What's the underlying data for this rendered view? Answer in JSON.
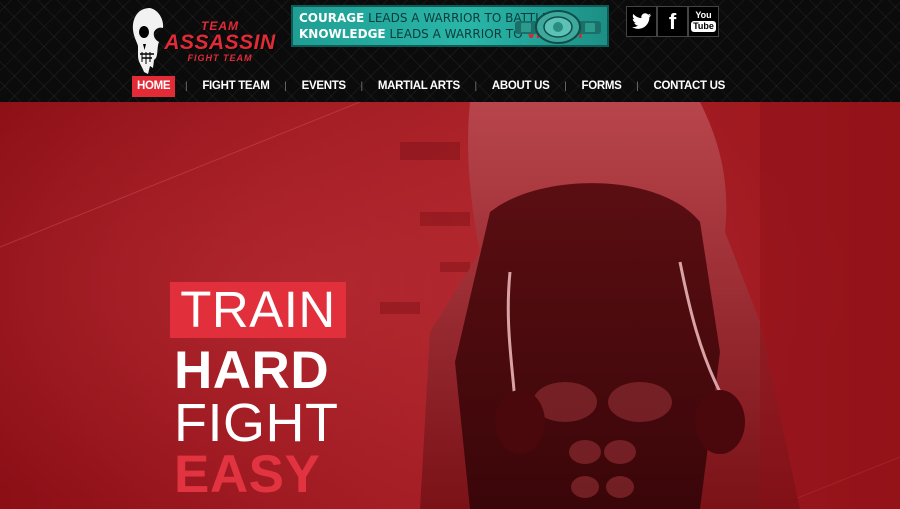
{
  "logo": {
    "line1": "TEAM",
    "line2": "ASSASSIN",
    "line3": "FIGHT TEAM"
  },
  "banner": {
    "line1": {
      "bold": "COURAGE",
      "rest": "LEADS A WARRIOR TO BATTLE"
    },
    "line2": {
      "bold": "KNOWLEDGE",
      "rest": "LEADS A WARRIOR TO",
      "accent": "VICTORY"
    }
  },
  "social": [
    {
      "name": "twitter-icon"
    },
    {
      "name": "facebook-icon",
      "glyph": "f"
    },
    {
      "name": "youtube-icon",
      "top": "You",
      "bottom": "Tube"
    }
  ],
  "nav": {
    "items": [
      {
        "label": "HOME",
        "active": true
      },
      {
        "label": "FIGHT TEAM",
        "active": false
      },
      {
        "label": "EVENTS",
        "active": false
      },
      {
        "label": "MARTIAL ARTS",
        "active": false
      },
      {
        "label": "ABOUT US",
        "active": false
      },
      {
        "label": "FORMS",
        "active": false
      },
      {
        "label": "CONTACT US",
        "active": false
      }
    ],
    "separator": "|"
  },
  "hero": {
    "line1": "TRAIN",
    "line2": "HARD",
    "line3": "FIGHT",
    "line4": "EASY"
  },
  "colors": {
    "accent_red": "#e22b36",
    "banner_teal": "#29b6a8",
    "header_bg": "#0b0b0b",
    "hero_red": "#a82026"
  }
}
